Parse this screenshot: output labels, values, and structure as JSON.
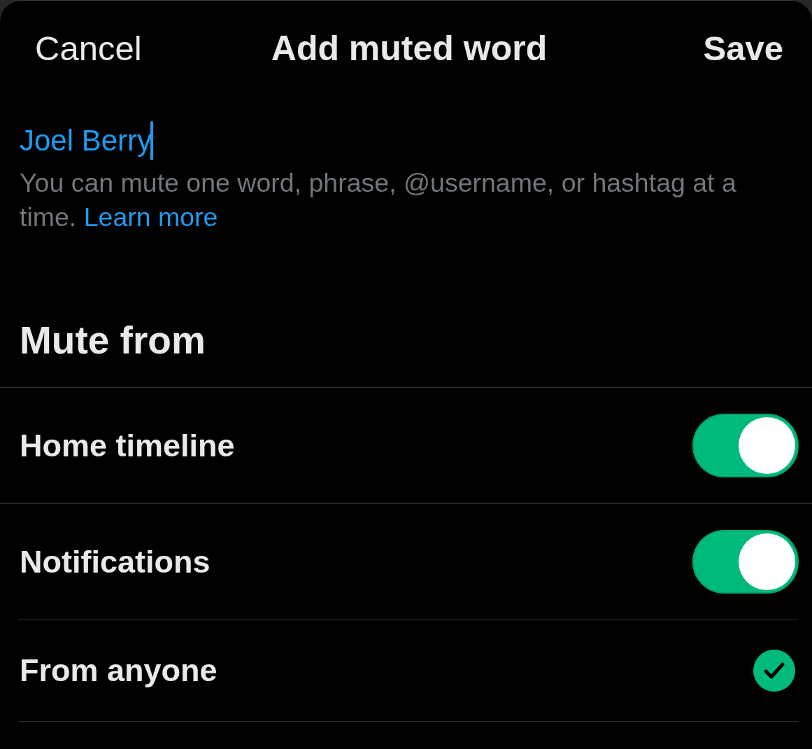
{
  "header": {
    "cancel": "Cancel",
    "title": "Add muted word",
    "save": "Save"
  },
  "word_input": {
    "value": "Joel Berry",
    "focused": true
  },
  "help": {
    "text": "You can mute one word, phrase, @username, or hashtag at a time.",
    "link": "Learn more"
  },
  "section_title": "Mute from",
  "options": [
    {
      "kind": "toggle",
      "label": "Home timeline",
      "on": true
    },
    {
      "kind": "toggle",
      "label": "Notifications",
      "on": true
    },
    {
      "kind": "choice",
      "label": "From anyone",
      "selected": true
    }
  ]
}
